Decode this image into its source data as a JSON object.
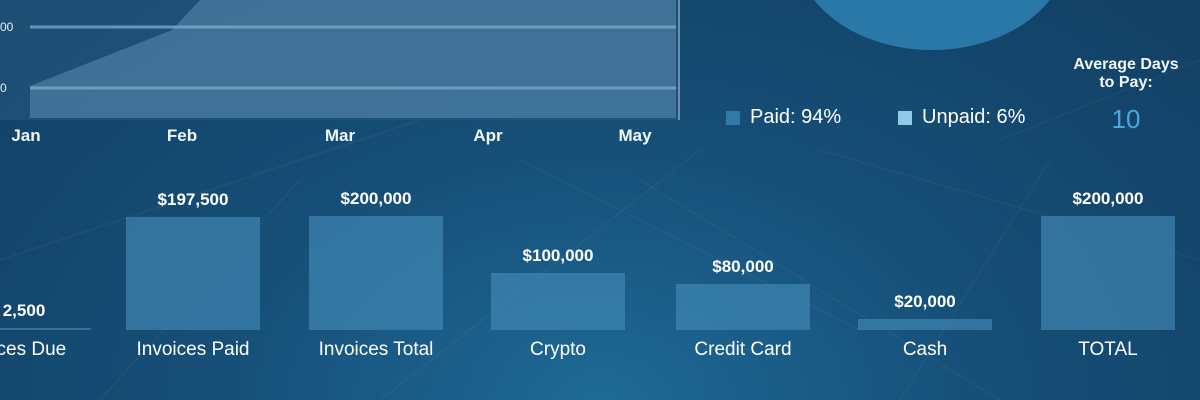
{
  "area_chart": {
    "months": [
      "Jan",
      "Feb",
      "Mar",
      "Apr",
      "May"
    ],
    "y_tick_labels": [
      "00",
      "0"
    ]
  },
  "pie": {
    "legend": [
      {
        "label": "Paid: 94%",
        "color": "#2e7aa8"
      },
      {
        "label": "Unpaid: 6%",
        "color": "#8ccbea"
      }
    ]
  },
  "average_days": {
    "label_line1": "Average Days",
    "label_line2": "to Pay:",
    "value": "10"
  },
  "chart_data": [
    {
      "type": "bar",
      "categories": [
        "Invoices Due",
        "Invoices Paid",
        "Invoices Total",
        "Crypto",
        "Credit Card",
        "Cash",
        "TOTAL"
      ],
      "display_labels": [
        "oices Due",
        "Invoices Paid",
        "Invoices Total",
        "Crypto",
        "Credit Card",
        "Cash",
        "TOTAL"
      ],
      "values": [
        2500,
        197500,
        200000,
        100000,
        80000,
        20000,
        200000
      ],
      "value_labels": [
        "2,500",
        "$197,500",
        "$200,000",
        "$100,000",
        "$80,000",
        "$20,000",
        "$200,000"
      ],
      "ylim": [
        0,
        200000
      ]
    },
    {
      "type": "area",
      "categories": [
        "Jan",
        "Feb",
        "Mar",
        "Apr",
        "May"
      ],
      "ylim": [
        0,
        100
      ]
    },
    {
      "type": "pie",
      "slices": [
        {
          "label": "Paid",
          "value": 94
        },
        {
          "label": "Unpaid",
          "value": 6
        }
      ]
    }
  ],
  "colors": {
    "background": "#164f78",
    "bar_fill": "#4b8cb9",
    "accent": "#4aa8de"
  }
}
